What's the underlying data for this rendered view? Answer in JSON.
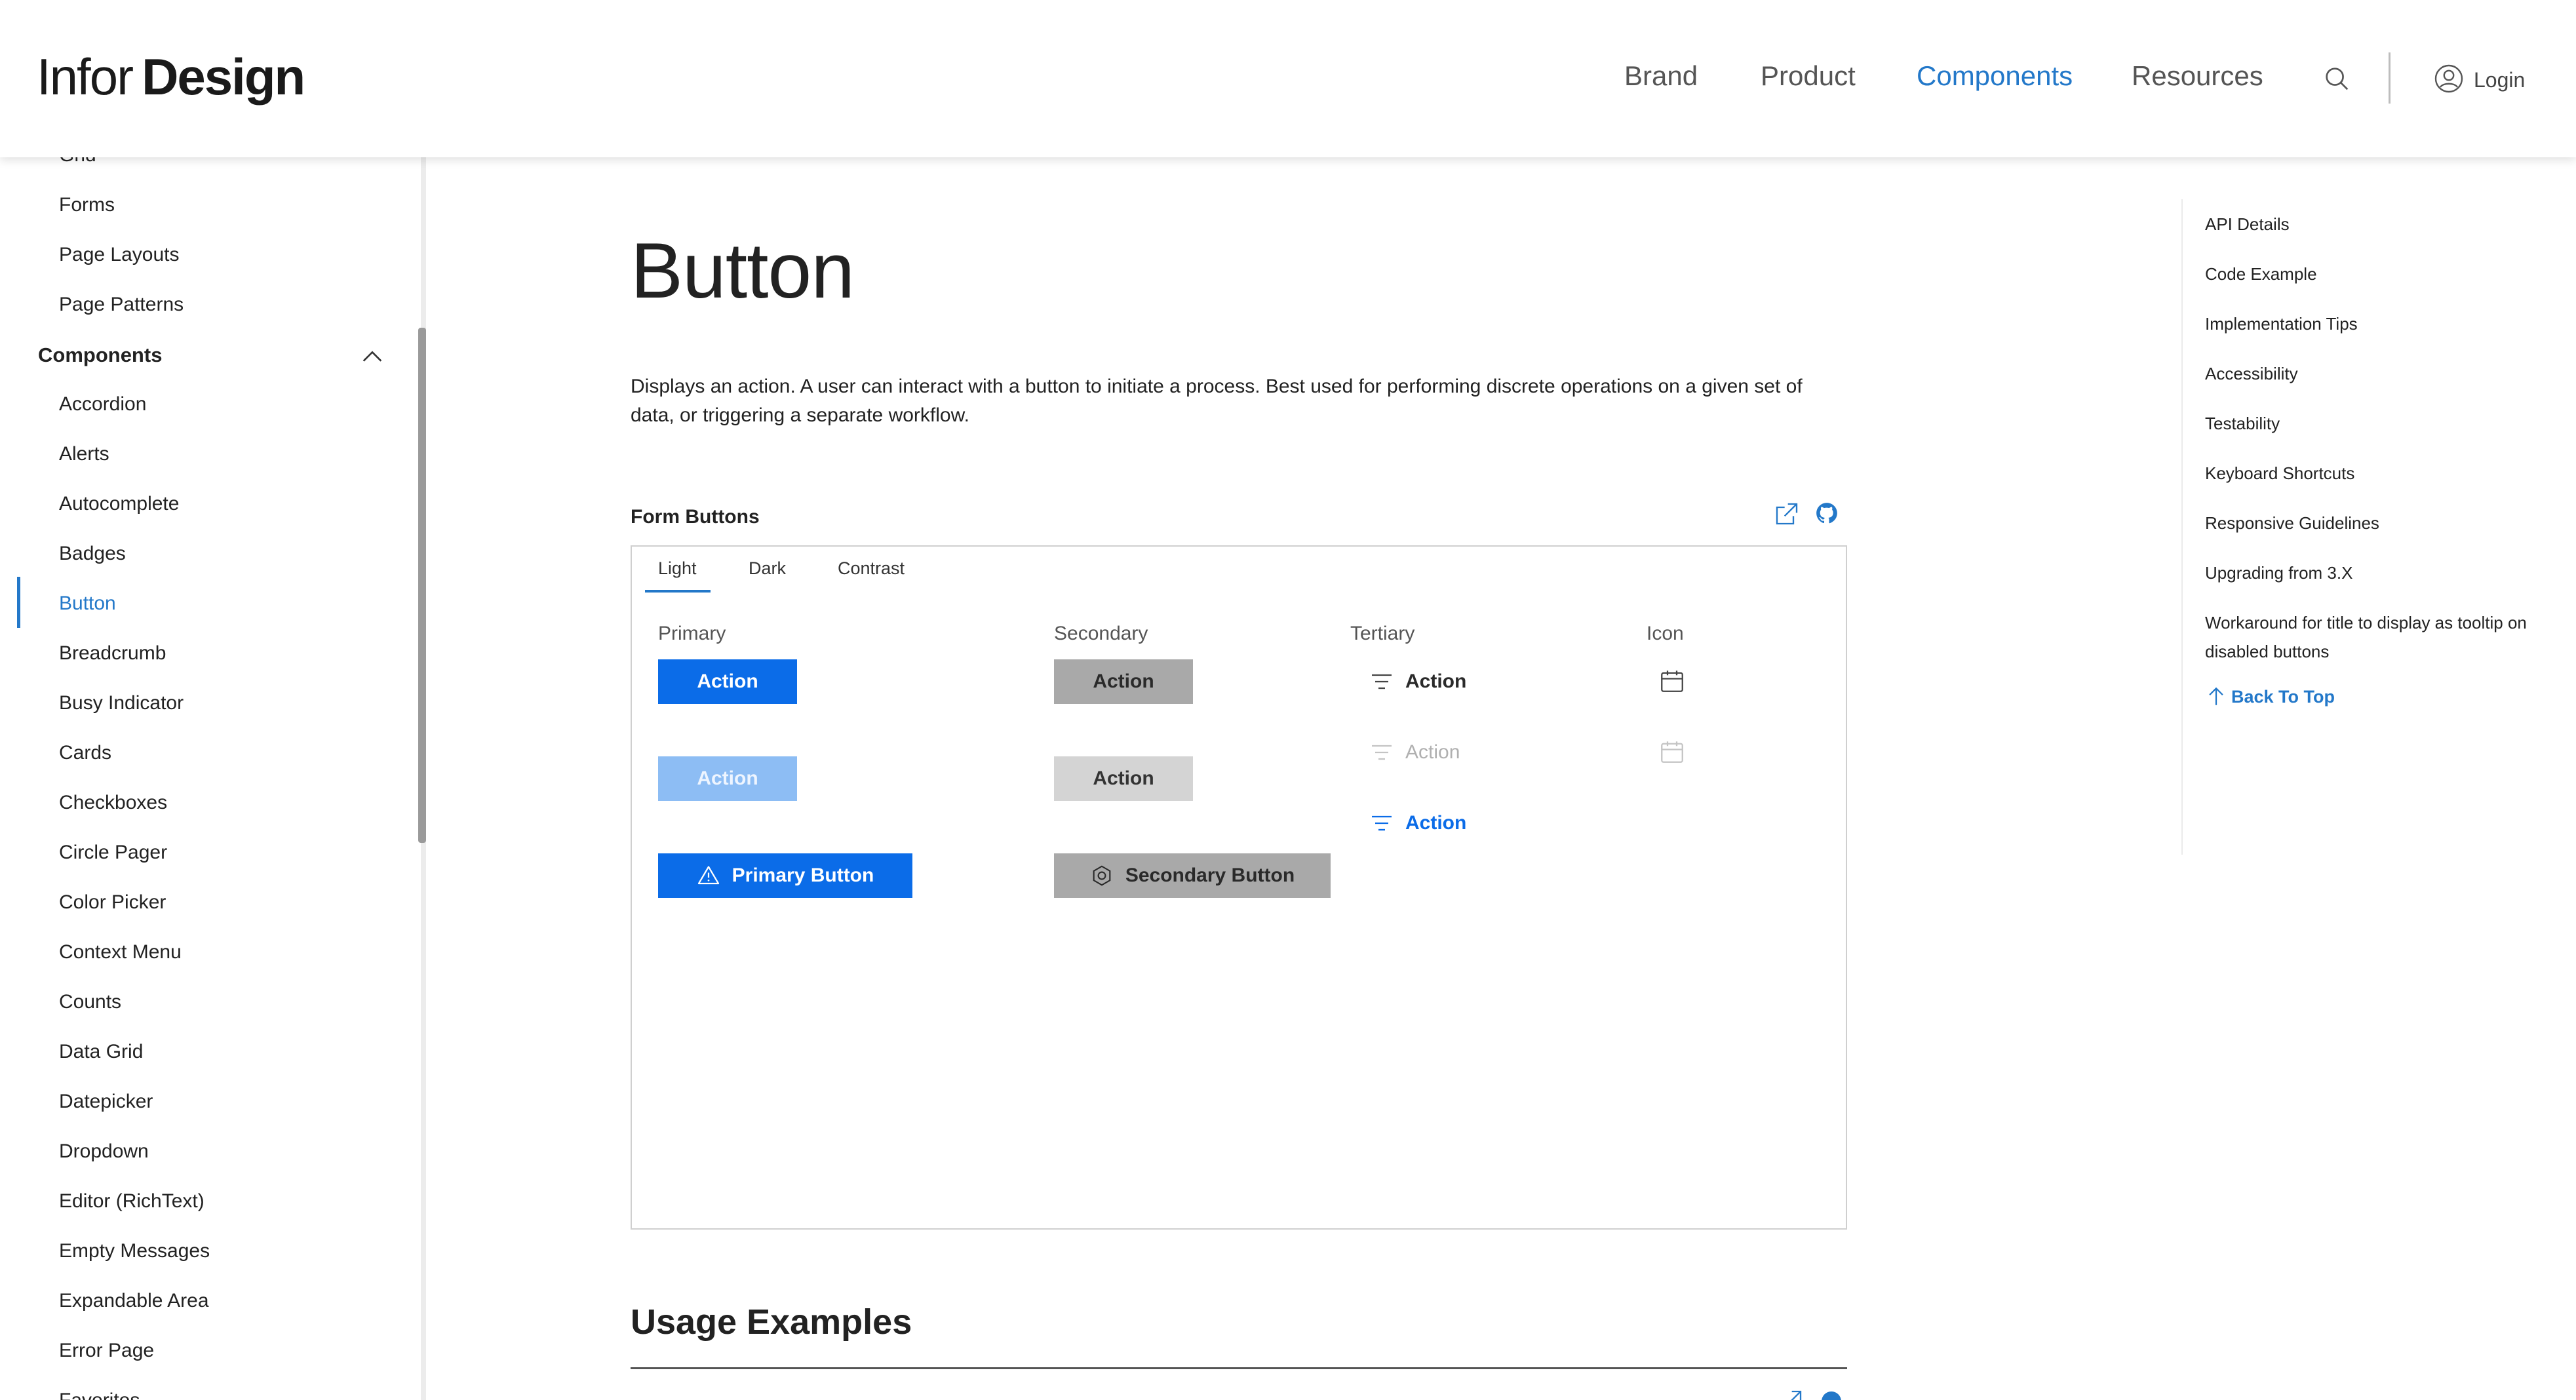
{
  "header": {
    "logo_part1": "Infor",
    "logo_part2": "Design",
    "nav": [
      "Brand",
      "Product",
      "Components",
      "Resources"
    ],
    "active_nav": "Components",
    "login_label": "Login"
  },
  "sidebar": {
    "items_top": [
      "Grid",
      "Forms",
      "Page Layouts",
      "Page Patterns"
    ],
    "section_heading": "Components",
    "items": [
      "Accordion",
      "Alerts",
      "Autocomplete",
      "Badges",
      "Button",
      "Breadcrumb",
      "Busy Indicator",
      "Cards",
      "Checkboxes",
      "Circle Pager",
      "Color Picker",
      "Context Menu",
      "Counts",
      "Data Grid",
      "Datepicker",
      "Dropdown",
      "Editor (RichText)",
      "Empty Messages",
      "Expandable Area",
      "Error Page",
      "Favorites"
    ],
    "active_item": "Button"
  },
  "main": {
    "title": "Button",
    "description": "Displays an action. A user can interact with a button to initiate a process. Best used for performing discrete operations on a given set of data, or triggering a separate workflow.",
    "section_label": "Form Buttons",
    "tabs": [
      "Light",
      "Dark",
      "Contrast"
    ],
    "active_tab": "Light",
    "columns": {
      "primary": "Primary",
      "secondary": "Secondary",
      "tertiary": "Tertiary",
      "icon": "Icon"
    },
    "buttons": {
      "primary_action": "Action",
      "primary_disabled": "Action",
      "primary_icon": "Primary Button",
      "secondary_action": "Action",
      "secondary_disabled": "Action",
      "secondary_icon": "Secondary Button",
      "tertiary_action": "Action",
      "tertiary_disabled": "Action",
      "tertiary_blue": "Action"
    },
    "usage_title": "Usage Examples"
  },
  "toc": {
    "items": [
      "API Details",
      "Code Example",
      "Implementation Tips",
      "Accessibility",
      "Testability",
      "Keyboard Shortcuts",
      "Responsive Guidelines",
      "Upgrading from 3.X",
      "Workaround for title to display as tooltip on disabled buttons"
    ],
    "back_to_top": "Back To Top"
  },
  "colors": {
    "accent": "#2378c9",
    "primary_button": "#0b6ce8",
    "secondary_button": "#a9a9a9"
  },
  "icons": [
    "search-icon",
    "user-icon",
    "chevron-up-icon",
    "external-link-icon",
    "github-icon",
    "alert-triangle-icon",
    "settings-icon",
    "filter-lines-icon",
    "calendar-icon",
    "arrow-up-icon"
  ]
}
